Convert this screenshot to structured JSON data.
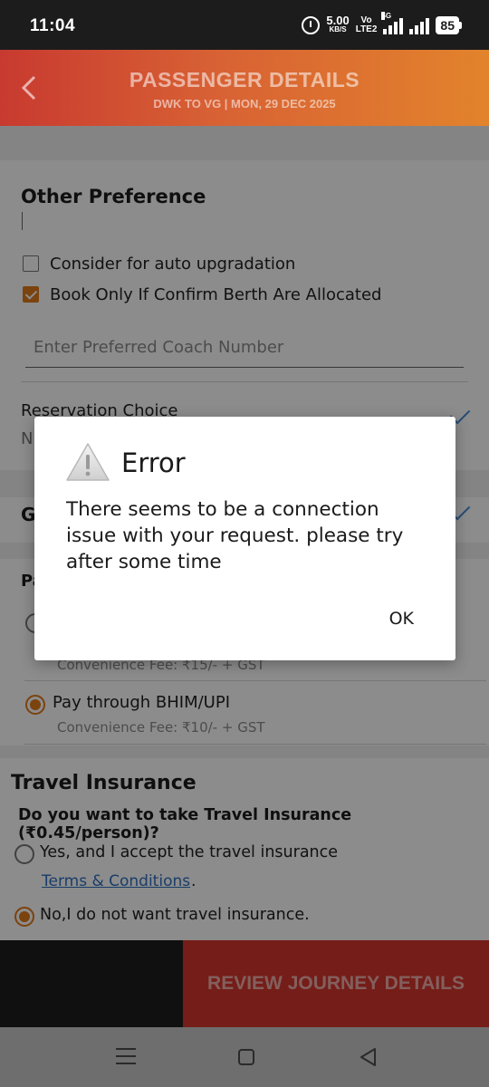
{
  "status_bar": {
    "time": "11:04",
    "net_speed": "5.00",
    "net_speed_unit": "KB/S",
    "volte_top": "Vo",
    "volte_bottom": "LTE2",
    "network": "5G",
    "battery": "85"
  },
  "header": {
    "title": "PASSENGER DETAILS",
    "subtitle": "DWK TO VG |  MON, 29 DEC  2025"
  },
  "other_preference": {
    "title": "Other Preference",
    "options": [
      {
        "label": "Consider for auto upgradation",
        "checked": false
      },
      {
        "label": "Book Only If Confirm Berth Are Allocated",
        "checked": true
      }
    ],
    "coach_placeholder": "Enter Preferred Coach Number",
    "reservation_choice": "Reservation Choice",
    "reservation_value_partial": "N"
  },
  "gst_section_partial": "G",
  "payment": {
    "title_partial": "Pa",
    "options": [
      {
        "label": "",
        "fee": "Convenience Fee: ₹15/- + GST",
        "selected": false
      },
      {
        "label": "Pay through BHIM/UPI",
        "fee": "Convenience Fee: ₹10/- + GST",
        "selected": true
      }
    ]
  },
  "travel_insurance": {
    "title": "Travel Insurance",
    "question": "Do you want to take Travel Insurance (₹0.45/person)?",
    "yes_label": "Yes, and I accept the travel insurance",
    "terms_link": "Terms & Conditions",
    "terms_suffix": ".",
    "no_label": "No,I do not want travel insurance.",
    "selected": "no"
  },
  "bottom_bar": {
    "review_button": "REVIEW JOURNEY DETAILS"
  },
  "dialog": {
    "title": "Error",
    "message": "There seems to be a connection issue with your request. please try after some time",
    "ok_button": "OK"
  },
  "colors": {
    "accent": "#e07a1a",
    "header_start": "#c83a30",
    "header_end": "#e2832c",
    "review_button": "#d5352c",
    "link": "#2f6fbf"
  }
}
